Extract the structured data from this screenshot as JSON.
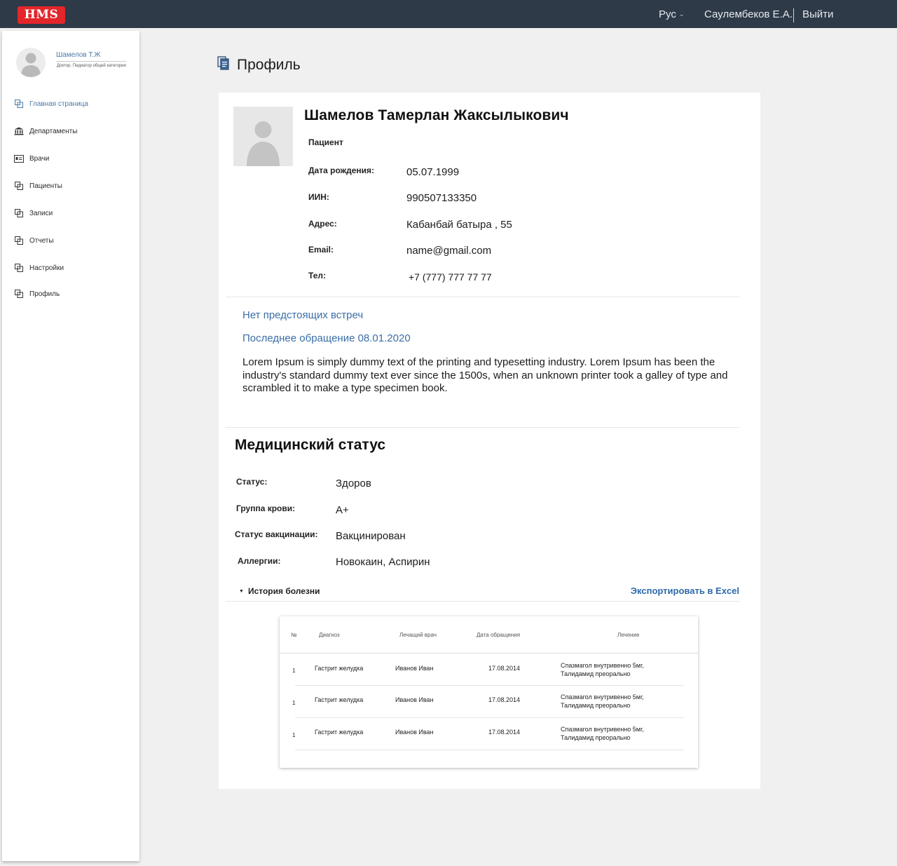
{
  "header": {
    "logo": "HMS",
    "language": "Рус",
    "user": "Саулембеков Е.А.",
    "logout": "Выйти"
  },
  "sidebar": {
    "user_name": "Шамелов Т.Ж",
    "user_role": "Доктор. Педиатор общей категории",
    "items": [
      {
        "label": "Главная страница",
        "icon": "home-icon"
      },
      {
        "label": "Департаменты",
        "icon": "bank-icon"
      },
      {
        "label": "Врачи",
        "icon": "id-card-icon"
      },
      {
        "label": "Пациенты",
        "icon": "copy-icon"
      },
      {
        "label": "Записи",
        "icon": "copy-icon"
      },
      {
        "label": "Отчеты",
        "icon": "copy-icon"
      },
      {
        "label": "Настройки",
        "icon": "copy-icon"
      },
      {
        "label": "Профиль",
        "icon": "copy-icon"
      }
    ],
    "active_index": 0
  },
  "page": {
    "title": "Профиль"
  },
  "profile": {
    "full_name": "Шамелов Тамерлан Жаксылыкович",
    "role": "Пациент",
    "fields": [
      {
        "label": "Дата рождения:",
        "value": "05.07.1999"
      },
      {
        "label": "ИИН:",
        "value": "990507133350"
      },
      {
        "label": "Адрес:",
        "value": "Кабанбай батыра , 55"
      },
      {
        "label": "Email:",
        "value": "name@gmail.com"
      },
      {
        "label": "Тел:",
        "value": "+7 (777) 777 77 77"
      }
    ]
  },
  "appointments": {
    "upcoming": "Нет предстоящих встреч",
    "last_visit": "Последнее обращение 08.01.2020",
    "notes": "Lorem Ipsum is simply dummy text of the printing and typesetting industry. Lorem Ipsum has been the industry's standard dummy text ever since the 1500s, when an unknown printer took a galley of type and scrambled it to make a type specimen book."
  },
  "medical": {
    "title": "Медицинский статус",
    "fields": [
      {
        "label": "Статус:",
        "value": "Здоров"
      },
      {
        "label": "Группа крови:",
        "value": "A+"
      },
      {
        "label": "Статус вакцинации:",
        "value": "Вакцинирован"
      },
      {
        "label": "Аллергии:",
        "value": "Новокаин, Аспирин"
      }
    ],
    "history_label": "История болезни",
    "export_label": "Экспортировать в Excel"
  },
  "history_table": {
    "columns": [
      "№",
      "Диагноз",
      "Лечащий врач",
      "Дата обращения",
      "Лечение"
    ],
    "rows": [
      {
        "num": "1",
        "diagnosis": "Гастрит желудка",
        "doctor": "Иванов Иван",
        "date": "17.08.2014",
        "treatment_1": "Спазмагол внутривенно 5мг,",
        "treatment_2": "Талидамид преорально"
      },
      {
        "num": "1",
        "diagnosis": "Гастрит желудка",
        "doctor": "Иванов Иван",
        "date": "17.08.2014",
        "treatment_1": "Спазмагол внутривенно 5мг,",
        "treatment_2": "Талидамид преорально"
      },
      {
        "num": "1",
        "diagnosis": "Гастрит желудка",
        "doctor": "Иванов Иван",
        "date": "17.08.2014",
        "treatment_1": "Спазмагол внутривенно 5мг,",
        "treatment_2": "Талидамид преорально"
      }
    ]
  },
  "colors": {
    "topbar": "#2e3a48",
    "logo": "#e3262a",
    "link": "#3b6ea7",
    "background": "#f0f0f0"
  }
}
